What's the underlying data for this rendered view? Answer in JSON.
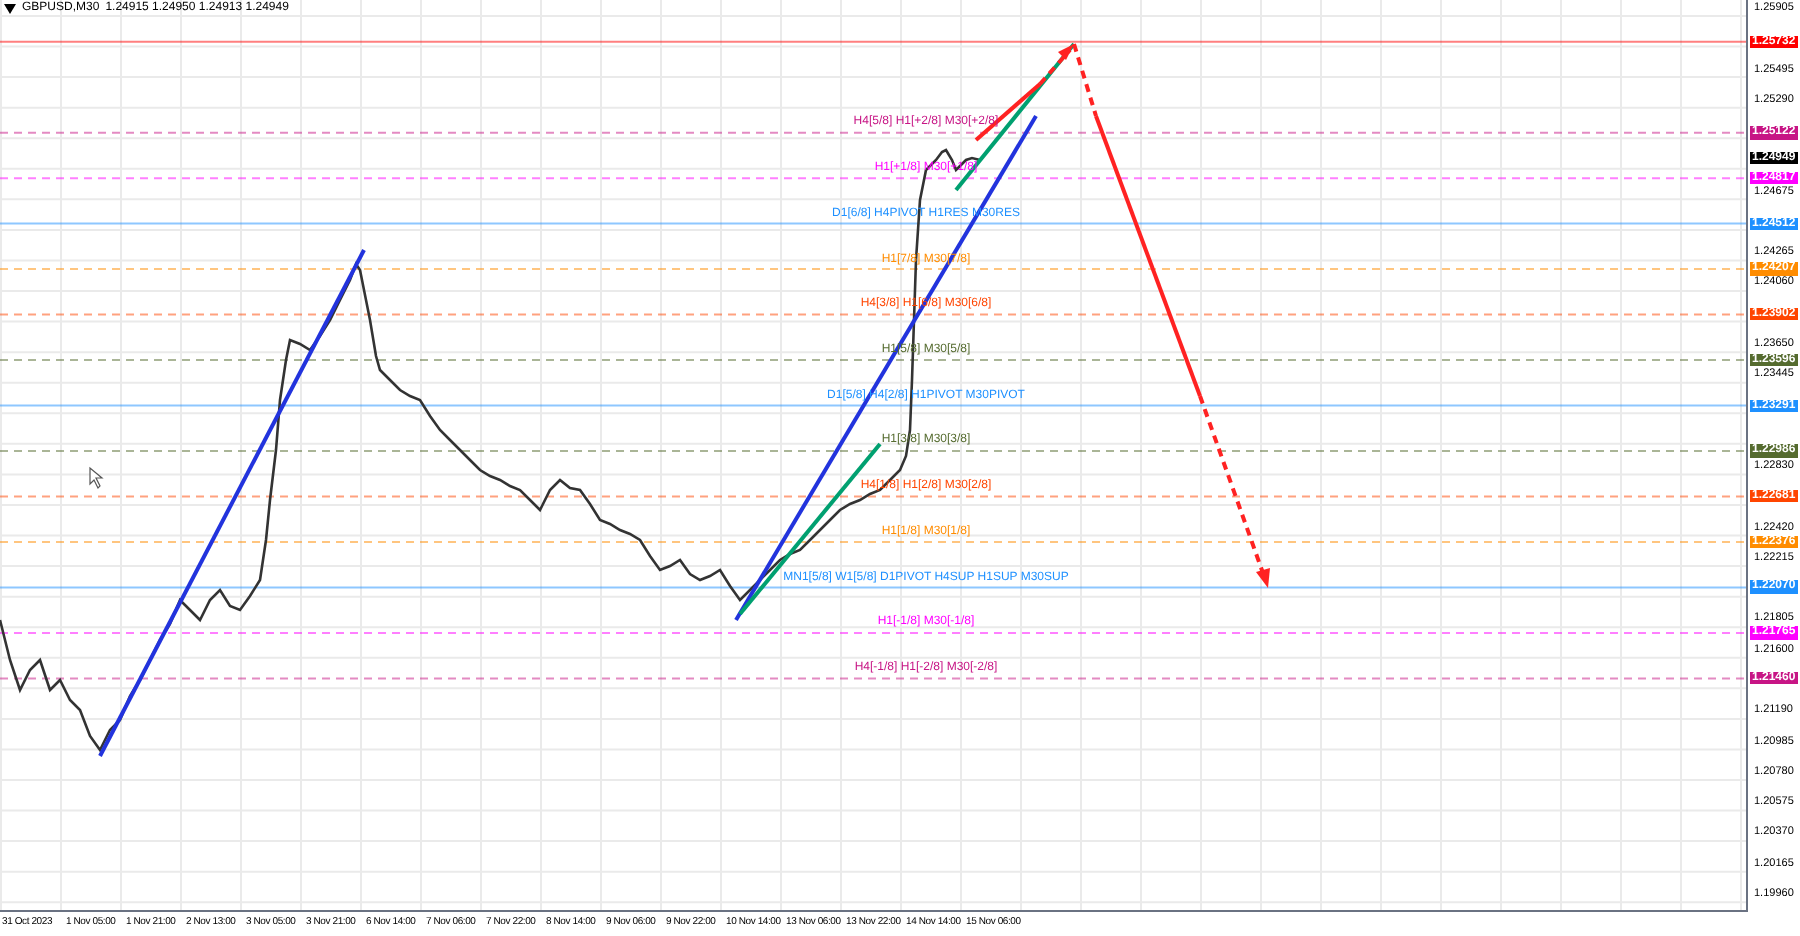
{
  "header": {
    "symbol": "GBPUSD,M30",
    "quote": "1.24915 1.24950 1.24913 1.24949"
  },
  "price_axis": [
    "1.25905",
    "1.25495",
    "1.25290",
    "1.24675",
    "1.24265",
    "1.24060",
    "1.23650",
    "1.23445",
    "1.22830",
    "1.22420",
    "1.22215",
    "1.21805",
    "1.21600",
    "1.21190",
    "1.20985",
    "1.20780",
    "1.20575",
    "1.20370",
    "1.20165",
    "1.19960"
  ],
  "levels": [
    {
      "price": "1.25732",
      "color": "#ff0000",
      "kind": "solid"
    },
    {
      "price": "1.25122",
      "color": "#c71585",
      "kind": "dashed",
      "label": "H4[5/8] H1[+2/8] M30[+2/8]"
    },
    {
      "price": "1.24949",
      "color": "#000000",
      "kind": "bid"
    },
    {
      "price": "1.24817",
      "color": "#ff00ff",
      "kind": "dashed",
      "label": "H1[+1/8] M30[+1/8]"
    },
    {
      "price": "1.24512",
      "color": "#1e90ff",
      "kind": "solid",
      "label": "D1[6/8] H4PIVOT H1RES M30RES"
    },
    {
      "price": "1.24207",
      "color": "#ff8c00",
      "kind": "dashed",
      "label": "H1[7/8] M30[7/8]"
    },
    {
      "price": "1.23902",
      "color": "#ff4500",
      "kind": "dashed",
      "label": "H4[3/8] H1[6/8] M30[6/8]"
    },
    {
      "price": "1.23596",
      "color": "#556b2f",
      "kind": "dashed",
      "label": "H1[5/8] M30[5/8]"
    },
    {
      "price": "1.23291",
      "color": "#1e90ff",
      "kind": "solid",
      "label": "D1[5/8] H4[2/8] H1PIVOT M30PIVOT"
    },
    {
      "price": "1.22986",
      "color": "#556b2f",
      "kind": "dashed",
      "label": "H1[3/8] M30[3/8]"
    },
    {
      "price": "1.22681",
      "color": "#ff4500",
      "kind": "dashed",
      "label": "H4[1/8] H1[2/8] M30[2/8]"
    },
    {
      "price": "1.22376",
      "color": "#ff8c00",
      "kind": "dashed",
      "label": "H1[1/8] M30[1/8]"
    },
    {
      "price": "1.22070",
      "color": "#1e90ff",
      "kind": "solid",
      "label": "MN1[5/8] W1[5/8] D1PIVOT H4SUP H1SUP M30SUP"
    },
    {
      "price": "1.21765",
      "color": "#ff00ff",
      "kind": "dashed",
      "label": "H1[-1/8] M30[-1/8]"
    },
    {
      "price": "1.21460",
      "color": "#c71585",
      "kind": "dashed",
      "label": "H4[-1/8] H1[-2/8] M30[-2/8]"
    }
  ],
  "time_axis": [
    "31 Oct 2023",
    "1 Nov 05:00",
    "1 Nov 21:00",
    "2 Nov 13:00",
    "3 Nov 05:00",
    "3 Nov 21:00",
    "6 Nov 14:00",
    "7 Nov 06:00",
    "7 Nov 22:00",
    "8 Nov 14:00",
    "9 Nov 06:00",
    "9 Nov 22:00",
    "10 Nov 14:00",
    "13 Nov 06:00",
    "13 Nov 22:00",
    "14 Nov 14:00",
    "15 Nov 06:00"
  ]
}
